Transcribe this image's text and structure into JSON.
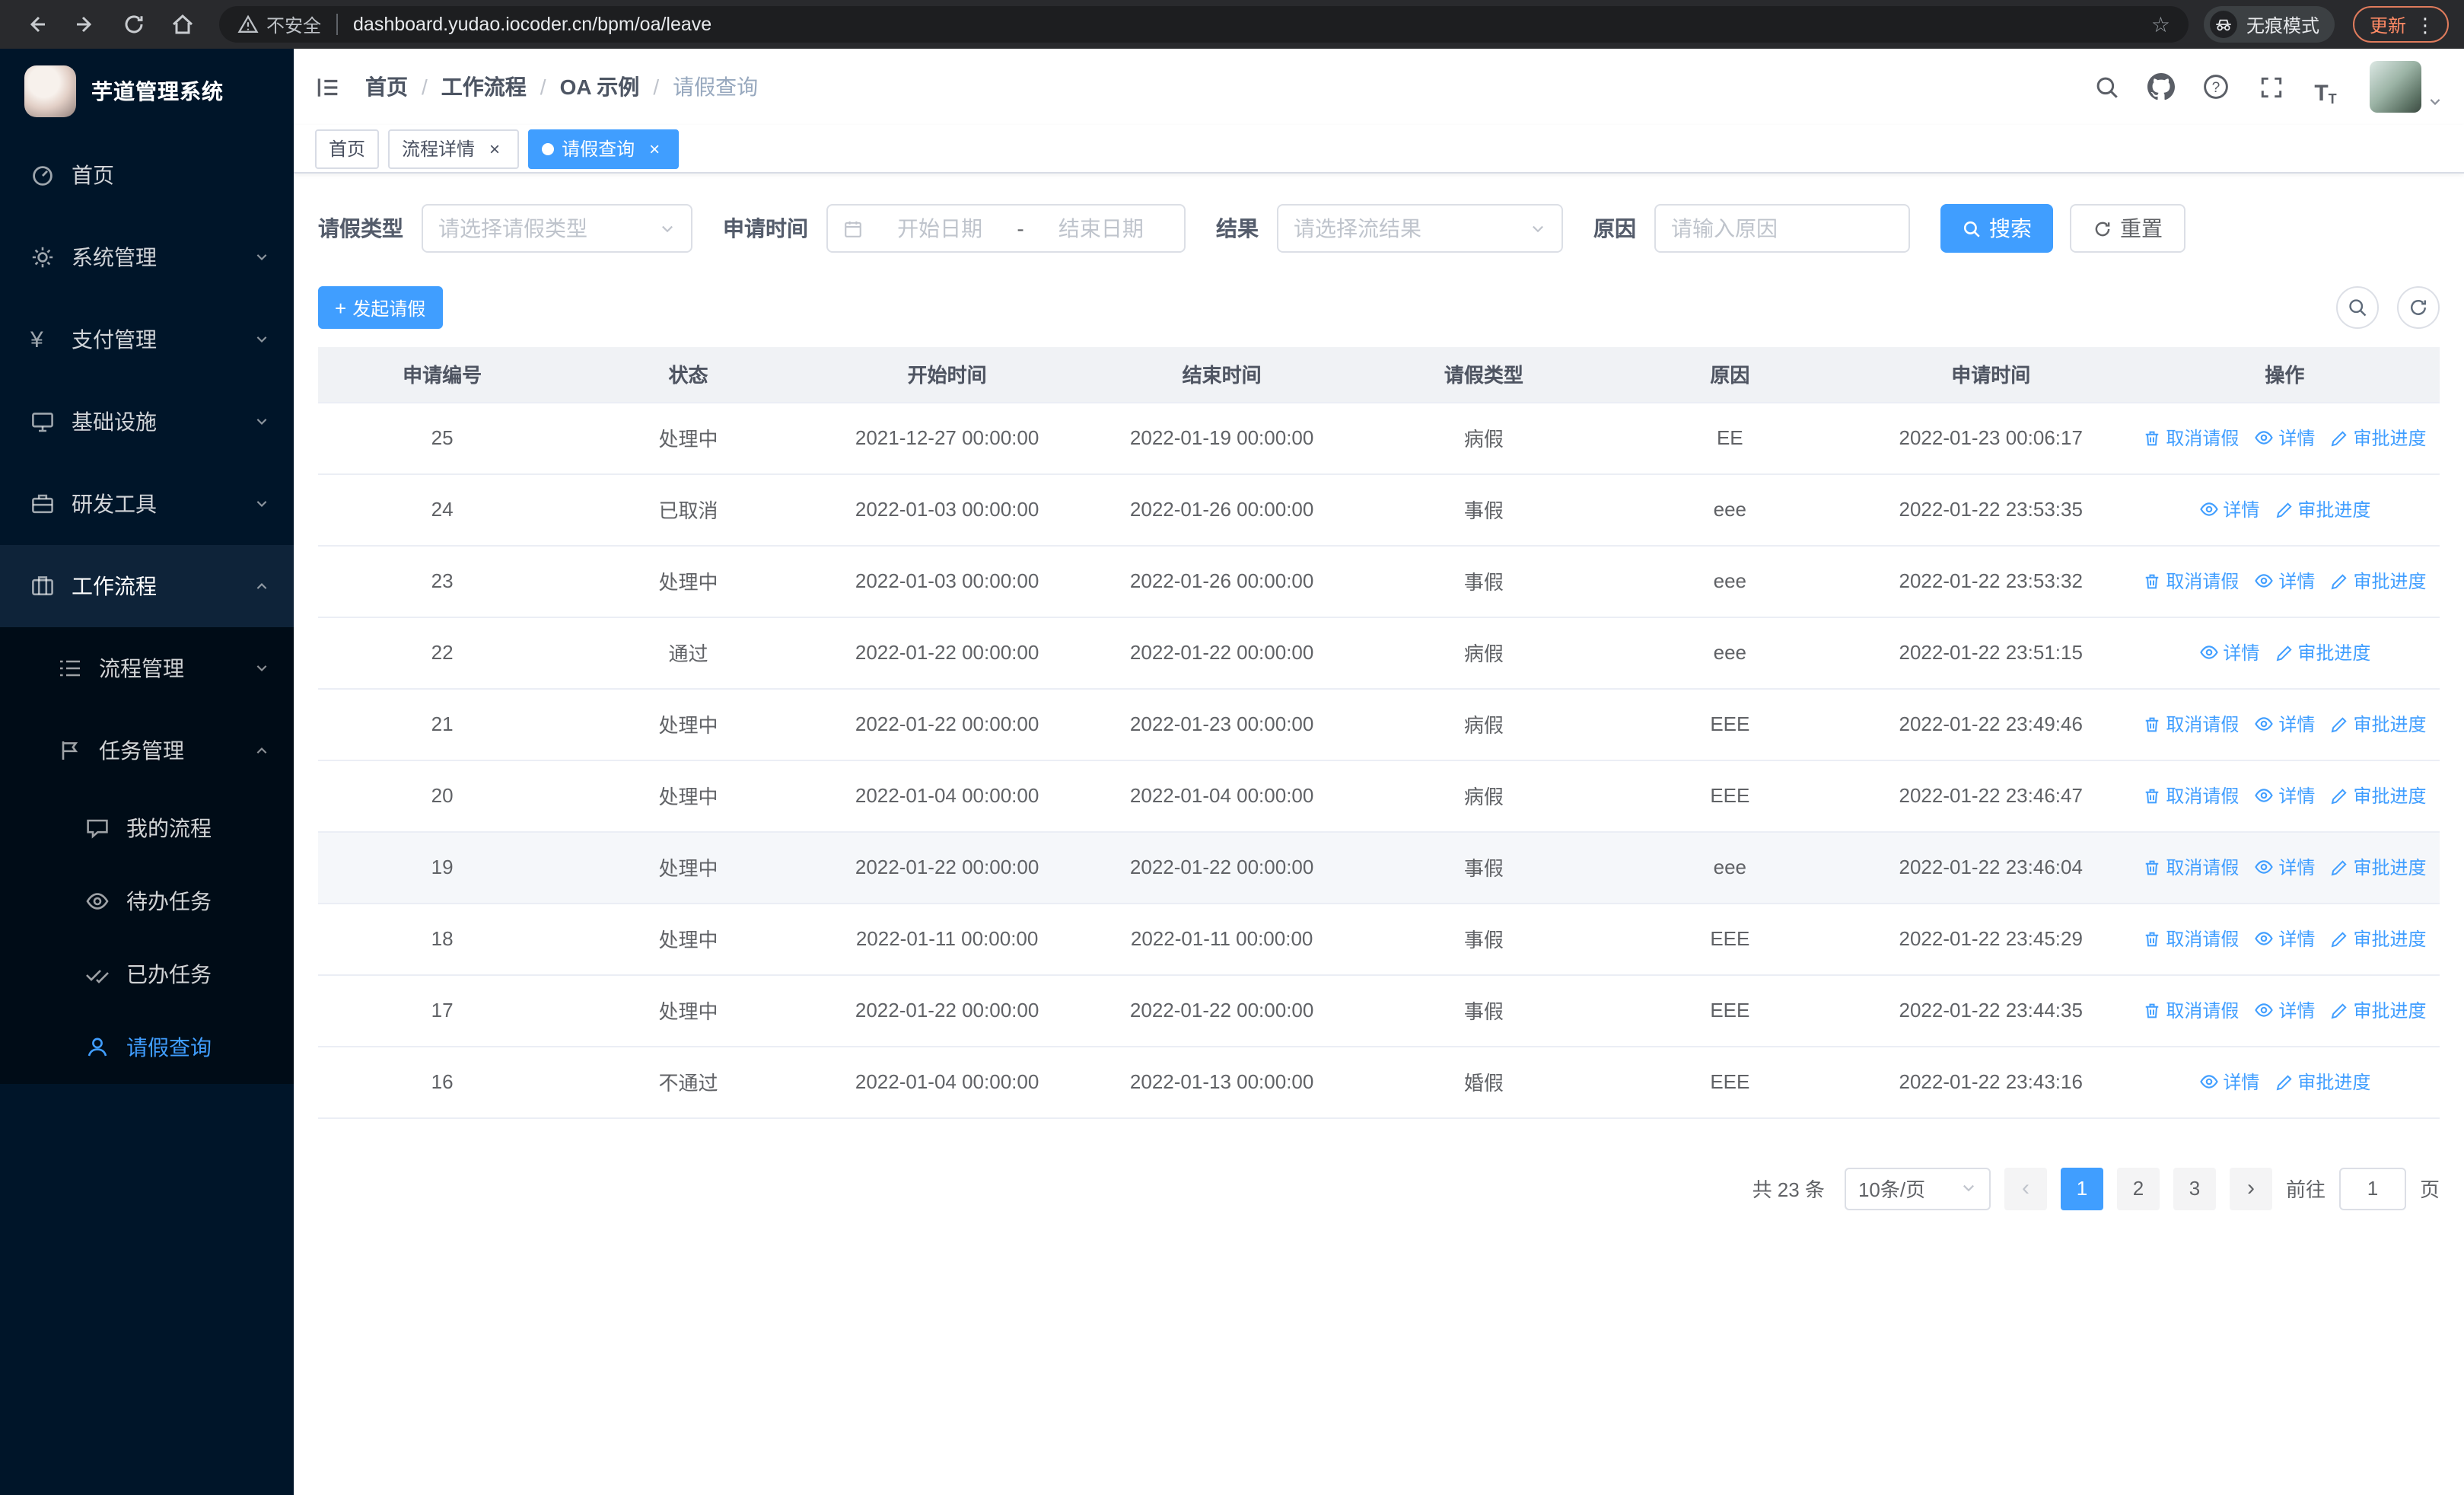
{
  "browser": {
    "security_label": "不安全",
    "url": "dashboard.yudao.iocoder.cn/bpm/oa/leave",
    "incognito_label": "无痕模式",
    "update_label": "更新"
  },
  "icons": {
    "star": "☆",
    "kebab": "⋮",
    "plus": "+",
    "prev_arrow": "‹",
    "next_arrow": "›",
    "yen": "¥",
    "big_t": "T",
    "small_t": "T"
  },
  "sidebar": {
    "logo_title": "芋道管理系统",
    "items": [
      {
        "label": "首页"
      },
      {
        "label": "系统管理"
      },
      {
        "label": "支付管理"
      },
      {
        "label": "基础设施"
      },
      {
        "label": "研发工具"
      },
      {
        "label": "工作流程"
      }
    ],
    "submenu": [
      {
        "label": "流程管理"
      },
      {
        "label": "任务管理"
      }
    ],
    "subitems": [
      {
        "label": "我的流程"
      },
      {
        "label": "待办任务"
      },
      {
        "label": "已办任务"
      },
      {
        "label": "请假查询"
      }
    ]
  },
  "header": {
    "breadcrumb": [
      "首页",
      "工作流程",
      "OA 示例",
      "请假查询"
    ],
    "breadcrumb_separator": "/"
  },
  "tabs": [
    {
      "label": "首页"
    },
    {
      "label": "流程详情"
    },
    {
      "label": "请假查询"
    }
  ],
  "filters": {
    "type_label": "请假类型",
    "type_placeholder": "请选择请假类型",
    "time_label": "申请时间",
    "date_start_placeholder": "开始日期",
    "date_separator": "-",
    "date_end_placeholder": "结束日期",
    "result_label": "结果",
    "result_placeholder": "请选择流结果",
    "reason_label": "原因",
    "reason_placeholder": "请输入原因",
    "search_label": "搜索",
    "reset_label": "重置"
  },
  "toolbar": {
    "create_label": "发起请假"
  },
  "table": {
    "columns": [
      "申请编号",
      "状态",
      "开始时间",
      "结束时间",
      "请假类型",
      "原因",
      "申请时间",
      "操作"
    ],
    "rows": [
      {
        "id": "25",
        "status": "处理中",
        "start": "2021-12-27 00:00:00",
        "end": "2022-01-19 00:00:00",
        "type": "病假",
        "reason": "EE",
        "applied": "2022-01-23 00:06:17",
        "highlighted": false,
        "actions": [
          {
            "key": "cancel",
            "label": "取消请假"
          },
          {
            "key": "view",
            "label": "详情"
          },
          {
            "key": "progress",
            "label": "审批进度"
          }
        ]
      },
      {
        "id": "24",
        "status": "已取消",
        "start": "2022-01-03 00:00:00",
        "end": "2022-01-26 00:00:00",
        "type": "事假",
        "reason": "eee",
        "applied": "2022-01-22 23:53:35",
        "highlighted": false,
        "actions": [
          {
            "key": "view",
            "label": "详情"
          },
          {
            "key": "progress",
            "label": "审批进度"
          }
        ]
      },
      {
        "id": "23",
        "status": "处理中",
        "start": "2022-01-03 00:00:00",
        "end": "2022-01-26 00:00:00",
        "type": "事假",
        "reason": "eee",
        "applied": "2022-01-22 23:53:32",
        "highlighted": false,
        "actions": [
          {
            "key": "cancel",
            "label": "取消请假"
          },
          {
            "key": "view",
            "label": "详情"
          },
          {
            "key": "progress",
            "label": "审批进度"
          }
        ]
      },
      {
        "id": "22",
        "status": "通过",
        "start": "2022-01-22 00:00:00",
        "end": "2022-01-22 00:00:00",
        "type": "病假",
        "reason": "eee",
        "applied": "2022-01-22 23:51:15",
        "highlighted": false,
        "actions": [
          {
            "key": "view",
            "label": "详情"
          },
          {
            "key": "progress",
            "label": "审批进度"
          }
        ]
      },
      {
        "id": "21",
        "status": "处理中",
        "start": "2022-01-22 00:00:00",
        "end": "2022-01-23 00:00:00",
        "type": "病假",
        "reason": "EEE",
        "applied": "2022-01-22 23:49:46",
        "highlighted": false,
        "actions": [
          {
            "key": "cancel",
            "label": "取消请假"
          },
          {
            "key": "view",
            "label": "详情"
          },
          {
            "key": "progress",
            "label": "审批进度"
          }
        ]
      },
      {
        "id": "20",
        "status": "处理中",
        "start": "2022-01-04 00:00:00",
        "end": "2022-01-04 00:00:00",
        "type": "病假",
        "reason": "EEE",
        "applied": "2022-01-22 23:46:47",
        "highlighted": false,
        "actions": [
          {
            "key": "cancel",
            "label": "取消请假"
          },
          {
            "key": "view",
            "label": "详情"
          },
          {
            "key": "progress",
            "label": "审批进度"
          }
        ]
      },
      {
        "id": "19",
        "status": "处理中",
        "start": "2022-01-22 00:00:00",
        "end": "2022-01-22 00:00:00",
        "type": "事假",
        "reason": "eee",
        "applied": "2022-01-22 23:46:04",
        "highlighted": true,
        "actions": [
          {
            "key": "cancel",
            "label": "取消请假"
          },
          {
            "key": "view",
            "label": "详情"
          },
          {
            "key": "progress",
            "label": "审批进度"
          }
        ]
      },
      {
        "id": "18",
        "status": "处理中",
        "start": "2022-01-11 00:00:00",
        "end": "2022-01-11 00:00:00",
        "type": "事假",
        "reason": "EEE",
        "applied": "2022-01-22 23:45:29",
        "highlighted": false,
        "actions": [
          {
            "key": "cancel",
            "label": "取消请假"
          },
          {
            "key": "view",
            "label": "详情"
          },
          {
            "key": "progress",
            "label": "审批进度"
          }
        ]
      },
      {
        "id": "17",
        "status": "处理中",
        "start": "2022-01-22 00:00:00",
        "end": "2022-01-22 00:00:00",
        "type": "事假",
        "reason": "EEE",
        "applied": "2022-01-22 23:44:35",
        "highlighted": false,
        "actions": [
          {
            "key": "cancel",
            "label": "取消请假"
          },
          {
            "key": "view",
            "label": "详情"
          },
          {
            "key": "progress",
            "label": "审批进度"
          }
        ]
      },
      {
        "id": "16",
        "status": "不通过",
        "start": "2022-01-04 00:00:00",
        "end": "2022-01-13 00:00:00",
        "type": "婚假",
        "reason": "EEE",
        "applied": "2022-01-22 23:43:16",
        "highlighted": false,
        "actions": [
          {
            "key": "view",
            "label": "详情"
          },
          {
            "key": "progress",
            "label": "审批进度"
          }
        ]
      }
    ]
  },
  "pagination": {
    "total": "共 23 条",
    "page_size": "10条/页",
    "pages": [
      "1",
      "2",
      "3"
    ],
    "active_page": "1",
    "goto_label": "前往",
    "goto_value": "1",
    "page_label": "页"
  }
}
